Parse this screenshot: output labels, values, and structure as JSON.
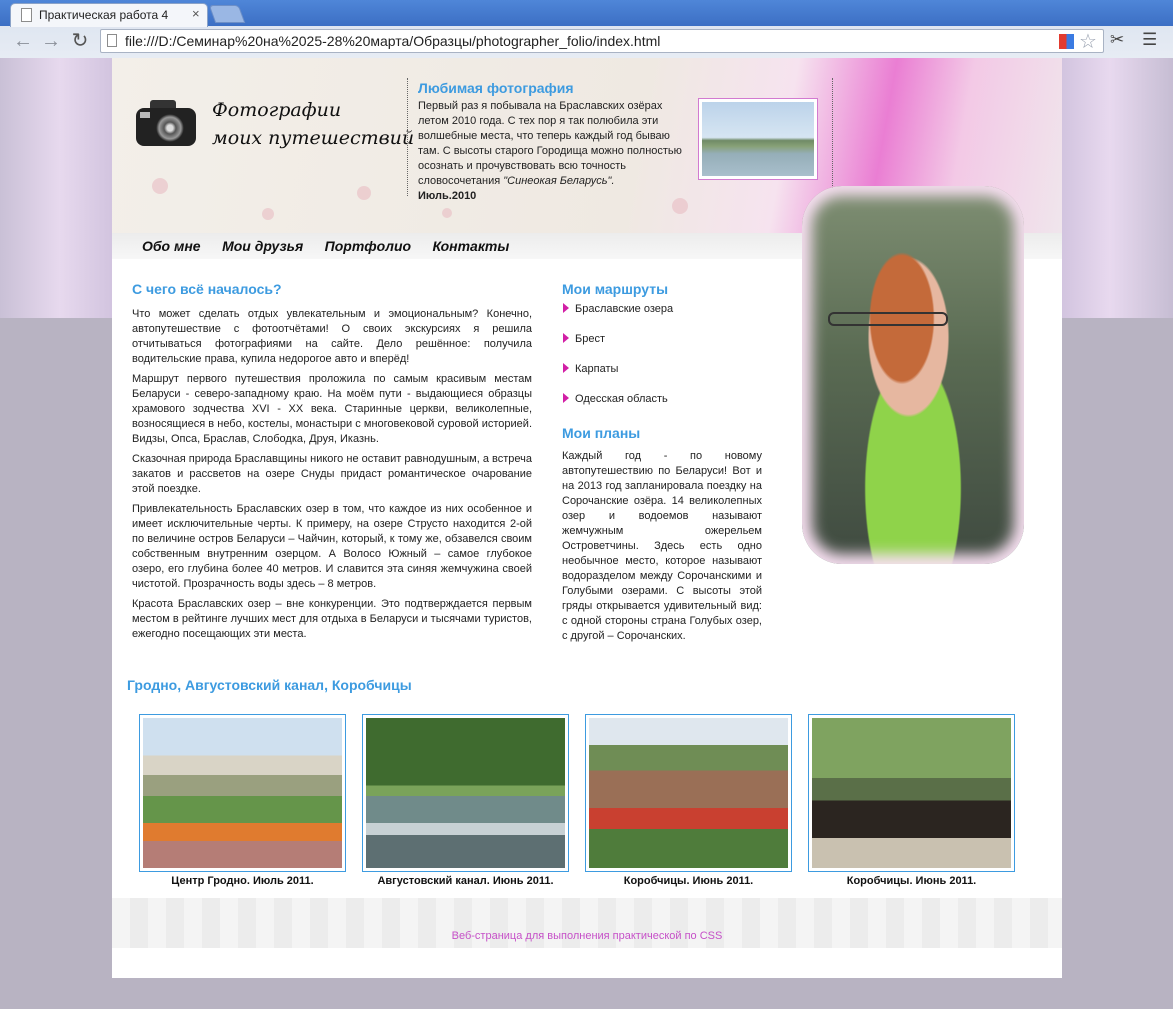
{
  "browser": {
    "tab_title": "Практическая работа 4",
    "close_glyph": "×",
    "url": "file:///D:/Семинар%20на%2025-28%20марта/Образцы/photographer_folio/index.html"
  },
  "header": {
    "logo_line1": "Фотографии",
    "logo_line2": "моих путешествий",
    "favorite": {
      "title": "Любимая фотография",
      "text": "Первый раз я побывала на Браславских озёрах летом 2010 года. С тех пор я так полюбила эти волшебные места, что теперь каждый год бываю там. С высоты старого Городища можно полностью осознать и прочувствовать всю точность словосочетания",
      "quote": "\"Синеокая Беларусь\".",
      "date": "Июль.2010"
    }
  },
  "nav": [
    "Обо мне",
    "Мои друзья",
    "Портфолио",
    "Контакты"
  ],
  "main": {
    "title": "С чего всё началось?",
    "paragraphs": [
      "Что может сделать отдых увлекательным и эмоциональным? Конечно, автопутешествие с фотоотчётами! О своих экскурсиях я решила отчитываться фотографиями на сайте. Дело решённое: получила водительские права, купила недорогое авто и вперёд!",
      "Маршрут первого путешествия проложила по самым красивым местам Беларуси - северо-западному краю. На моём пути - выдающиеся образцы храмового зодчества XVI - XX века. Старинные церкви, великолепные, возносящиеся в небо, костелы, монастыри с многовековой суровой историей. Видзы, Опса, Браслав, Слободка, Друя, Иказнь.",
      "Сказочная природа Браславщины никого не оставит равнодушным, а встреча закатов и рассветов на озере Снуды придаст романтическое очарование этой поездке.",
      "Привлекательность Браславских озер в том, что каждое из них особенное и имеет исключительные черты. К примеру, на озере Струсто находится 2-ой по величине остров Беларуси – Чайчин, который, к тому же, обзавелся своим собственным внутренним озерцом. А Волосо Южный – самое глубокое озеро, его глубина более 40 метров. И славится эта синяя жемчужина своей чистотой. Прозрачность воды здесь – 8 метров.",
      "Красота Браславских озер – вне конкуренции. Это подтверждается первым местом в рейтинге лучших мест для отдыха в Беларуси и тысячами туристов, ежегодно посещающих эти места."
    ]
  },
  "routes": {
    "title": "Мои маршруты",
    "items": [
      "Браславские озера",
      "Брест",
      "Карпаты",
      "Одесская область"
    ]
  },
  "plans": {
    "title": "Мои планы",
    "text": "Каждый год - по новому автопутешествию по Беларуси! Вот и на 2013 год запланировала поездку на Сорочанские озёра. 14 великолепных озер и водоемов называют жемчужным ожерельем Островетчины. Здесь есть одно необычное место, которое называют водоразделом между Сорочанскими и Голубыми озерами. С высоты этой гряды открывается удивительный вид: с одной стороны страна Голубых озер, с другой – Сорочанских."
  },
  "gallery": {
    "title": "Гродно, Августовский канал, Коробчицы",
    "items": [
      {
        "caption": "Центр Гродно. Июль 2011."
      },
      {
        "caption": "Августовский канал. Июнь 2011."
      },
      {
        "caption": "Коробчицы. Июнь 2011."
      },
      {
        "caption": "Коробчицы. Июнь 2011."
      }
    ]
  },
  "footer": {
    "text": "Веб-страница для выполнения практической по CSS"
  },
  "colors": {
    "accent": "#3d9be0",
    "footer_text": "#c650c8",
    "arrow": "#d21fa6"
  }
}
